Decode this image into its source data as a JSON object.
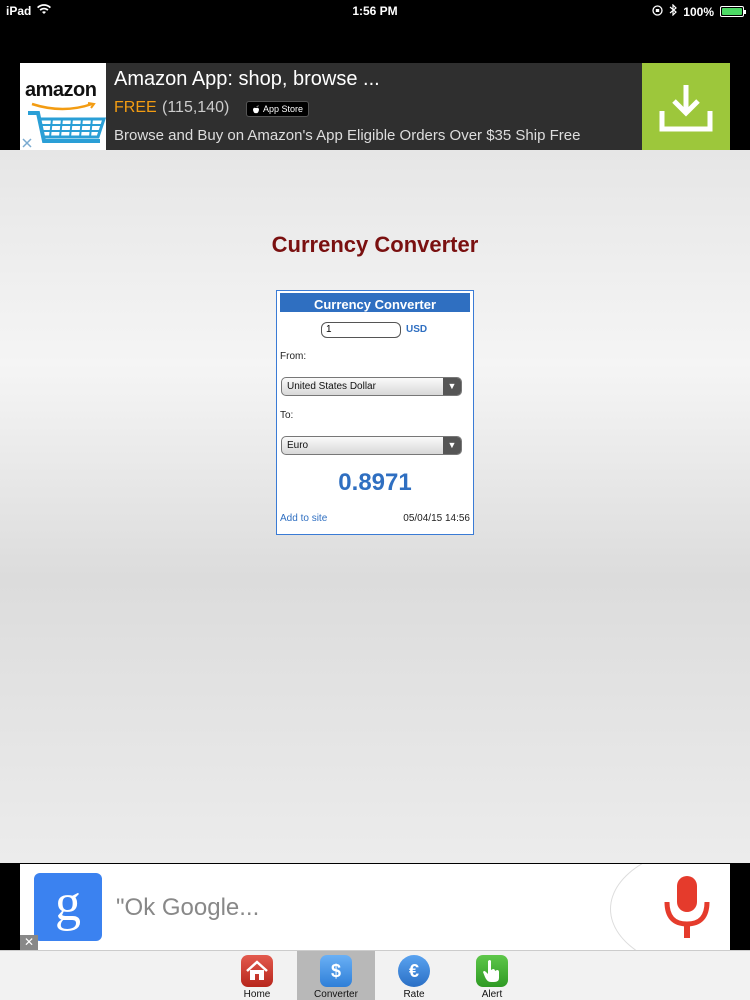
{
  "status_bar": {
    "device": "iPad",
    "time": "1:56 PM",
    "battery": "100%"
  },
  "top_ad": {
    "logo_text": "amazon",
    "title": "Amazon App: shop, browse ...",
    "price": "FREE",
    "rating_count": "(115,140)",
    "store_badge": "App Store",
    "description": "Browse and Buy on Amazon's App Eligible Orders Over $35 Ship Free",
    "accent_color": "#9dc73b"
  },
  "page": {
    "title": "Currency Converter",
    "title_color": "#7a1010"
  },
  "widget": {
    "header": "Currency Converter",
    "amount_value": "1",
    "amount_unit": "USD",
    "from_label": "From:",
    "from_value": "United States Dollar",
    "to_label": "To:",
    "to_value": "Euro",
    "result": "0.8971",
    "add_link": "Add to site",
    "timestamp": "05/04/15 14:56",
    "accent_color": "#2f6fc1"
  },
  "bottom_ad": {
    "icon_letter": "g",
    "prompt": "\"Ok Google...",
    "close_glyph": "✕"
  },
  "tab_bar": {
    "tabs": [
      {
        "label": "Home",
        "icon": "home-icon"
      },
      {
        "label": "Converter",
        "icon": "dollar-icon",
        "active": true
      },
      {
        "label": "Rate",
        "icon": "euro-icon"
      },
      {
        "label": "Alert",
        "icon": "hand-pointer-icon"
      }
    ],
    "dollar_glyph": "$",
    "euro_glyph": "€"
  }
}
